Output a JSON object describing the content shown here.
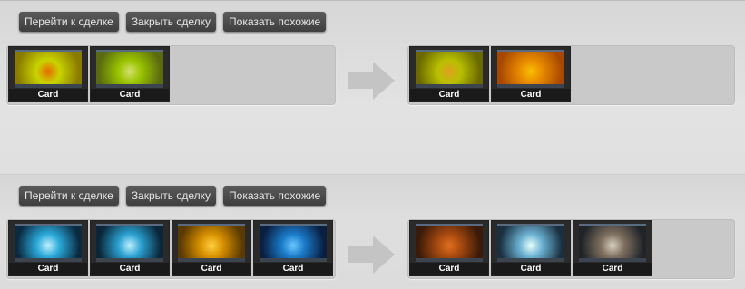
{
  "trades": [
    {
      "buttons": {
        "go_label": "Перейти к сделке",
        "close_label": "Закрыть сделку",
        "similar_label": "Показать похожие"
      },
      "give": [
        {
          "label": "Card",
          "colors": [
            "#c8d400",
            "#8a7a00",
            "#e86a00"
          ]
        },
        {
          "label": "Card",
          "colors": [
            "#9ac400",
            "#5a6a10",
            "#d4e070"
          ]
        }
      ],
      "get": [
        {
          "label": "Card",
          "colors": [
            "#b8c000",
            "#6a6800",
            "#e0a020"
          ]
        },
        {
          "label": "Card",
          "colors": [
            "#e88a00",
            "#a84800",
            "#f8c000"
          ]
        }
      ]
    },
    {
      "buttons": {
        "go_label": "Перейти к сделке",
        "close_label": "Закрыть сделку",
        "similar_label": "Показать похожие"
      },
      "give": [
        {
          "label": "Card",
          "colors": [
            "#2aa8d8",
            "#0a2a40",
            "#bff0ff"
          ]
        },
        {
          "label": "Card",
          "colors": [
            "#2aa0d0",
            "#0a2638",
            "#c0f0ff"
          ]
        },
        {
          "label": "Card",
          "colors": [
            "#d89000",
            "#5a3a00",
            "#ffd040"
          ]
        },
        {
          "label": "Card",
          "colors": [
            "#1a7ac8",
            "#0a1e40",
            "#6ac8ff"
          ]
        }
      ],
      "get": [
        {
          "label": "Card",
          "colors": [
            "#a84a10",
            "#3a1a08",
            "#e07020"
          ]
        },
        {
          "label": "Card",
          "colors": [
            "#6ab0d0",
            "#1a3040",
            "#e8ffff"
          ]
        },
        {
          "label": "Card",
          "colors": [
            "#807060",
            "#202428",
            "#d8d0c0"
          ]
        }
      ]
    }
  ]
}
